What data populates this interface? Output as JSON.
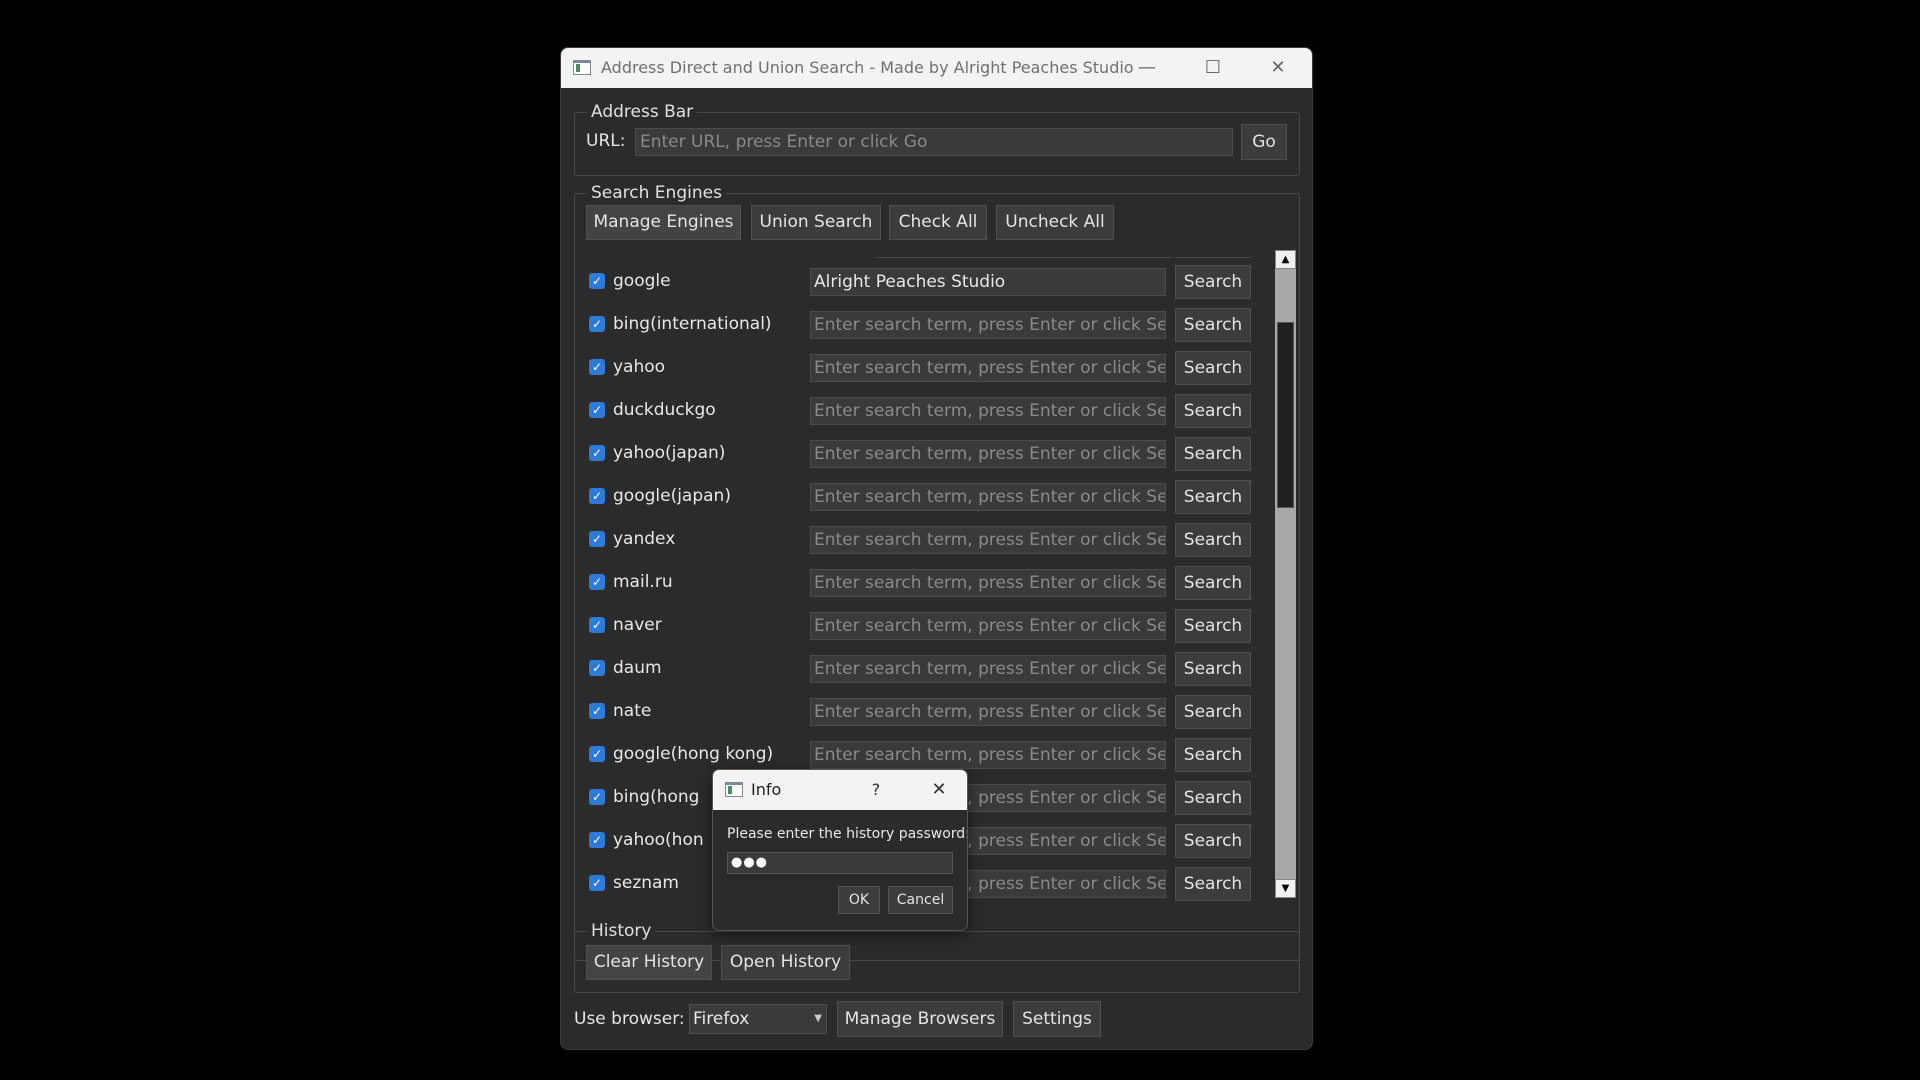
{
  "window": {
    "title": "Address Direct and Union Search - Made by Alright Peaches Studio",
    "minimize_glyph": "—",
    "maximize_glyph": "☐",
    "close_glyph": "✕"
  },
  "address_bar": {
    "group_title": "Address Bar",
    "url_label": "URL:",
    "url_placeholder": "Enter URL, press Enter or click Go",
    "go_label": "Go"
  },
  "search_engines": {
    "group_title": "Search Engines",
    "toolbar": {
      "manage_engines": "Manage Engines",
      "union_search": "Union Search",
      "check_all": "Check All",
      "uncheck_all": "Uncheck All"
    },
    "search_button_label": "Search",
    "input_placeholder": "Enter search term, press Enter or click Se...",
    "engines": [
      {
        "name": "google",
        "checked": true,
        "value": "Alright Peaches Studio"
      },
      {
        "name": "bing(international)",
        "checked": true,
        "value": ""
      },
      {
        "name": "yahoo",
        "checked": true,
        "value": ""
      },
      {
        "name": "duckduckgo",
        "checked": true,
        "value": ""
      },
      {
        "name": "yahoo(japan)",
        "checked": true,
        "value": ""
      },
      {
        "name": "google(japan)",
        "checked": true,
        "value": ""
      },
      {
        "name": "yandex",
        "checked": true,
        "value": ""
      },
      {
        "name": "mail.ru",
        "checked": true,
        "value": ""
      },
      {
        "name": "naver",
        "checked": true,
        "value": ""
      },
      {
        "name": "daum",
        "checked": true,
        "value": ""
      },
      {
        "name": "nate",
        "checked": true,
        "value": ""
      },
      {
        "name": "google(hong kong)",
        "checked": true,
        "value": ""
      },
      {
        "name": "bing(hong",
        "checked": true,
        "value": ""
      },
      {
        "name": "yahoo(hon",
        "checked": true,
        "value": ""
      },
      {
        "name": "seznam",
        "checked": true,
        "value": ""
      }
    ],
    "covered_placeholder": "press Enter or click Se..."
  },
  "history": {
    "group_title": "History",
    "clear_label": "Clear History",
    "open_label": "Open History"
  },
  "footer": {
    "browser_label": "Use browser:",
    "browser_selected": "Firefox",
    "manage_browsers": "Manage Browsers",
    "settings": "Settings"
  },
  "dialog": {
    "title": "Info",
    "help_glyph": "?",
    "close_glyph": "✕",
    "prompt": "Please enter the history password:",
    "password_mask": "●●●",
    "ok": "OK",
    "cancel": "Cancel"
  },
  "colors": {
    "window_bg": "#2b2b2b",
    "titlebar_bg": "#f3f3f3",
    "checkbox_accent": "#2f7ad6"
  }
}
